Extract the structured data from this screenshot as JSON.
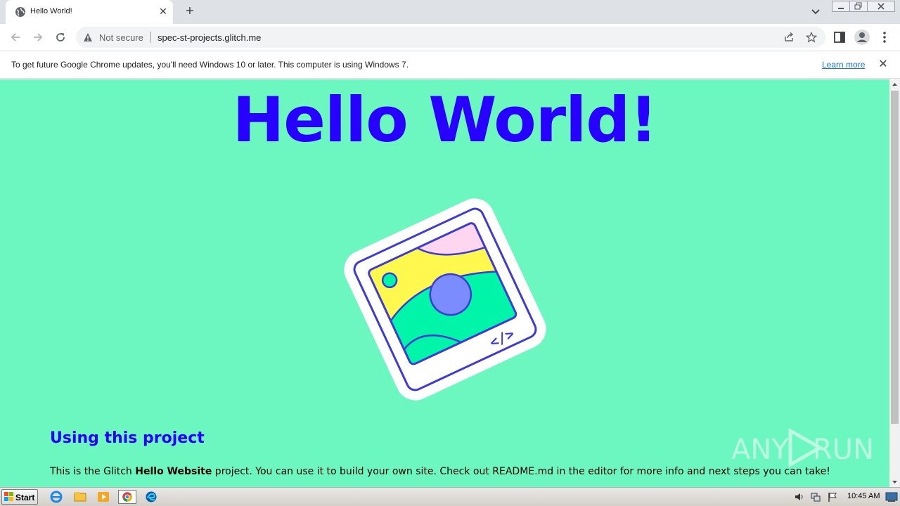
{
  "browser": {
    "tab": {
      "title": "Hello World!",
      "close_glyph": "✕",
      "favicon": "globe-icon"
    },
    "new_tab_glyph": "+",
    "address": {
      "security_label": "Not secure",
      "url": "spec-st-projects.glitch.me"
    },
    "infobar": {
      "message": "To get future Google Chrome updates, you'll need Windows 10 or later. This computer is using Windows 7.",
      "link": "Learn more",
      "close_glyph": "✕"
    }
  },
  "page": {
    "title": "Hello World!",
    "section_heading": "Using this project",
    "body_prefix": "This is the Glitch ",
    "body_bold": "Hello Website",
    "body_suffix": " project. You can use it to build your own site. Check out README.md in the editor for more info and next steps you can take!",
    "code_glyph": "</>",
    "background_color": "#6cf7c1",
    "accent_color": "#2800ff"
  },
  "watermark": {
    "text_left": "ANY",
    "text_right": "RUN"
  },
  "taskbar": {
    "start_label": "Start",
    "clock": "10:45 AM",
    "pinned": [
      "internet-explorer-icon",
      "file-explorer-icon",
      "media-player-icon",
      "chrome-icon",
      "edge-icon"
    ]
  }
}
